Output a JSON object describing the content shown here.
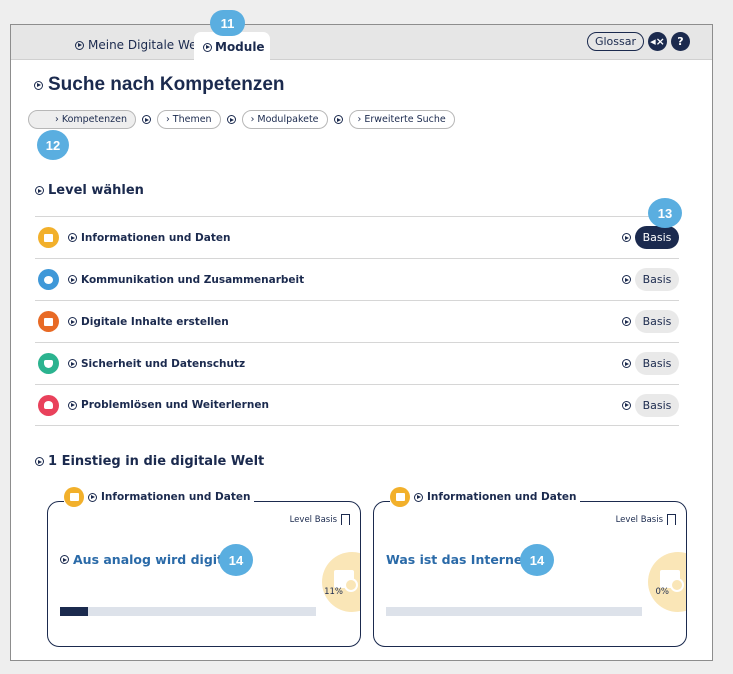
{
  "nav": {
    "tabs": [
      {
        "label": "Meine Digitale Welt",
        "active": false
      },
      {
        "label": "Module",
        "active": true
      }
    ],
    "glossar_label": "Glossar",
    "icons": {
      "sound": "speaker-mute-icon",
      "help": "help-icon"
    }
  },
  "markers": {
    "m11": "11",
    "m12": "12",
    "m13": "13",
    "m14a": "14",
    "m14b": "14"
  },
  "page": {
    "title": "Suche nach Kompetenzen",
    "filters": [
      {
        "label": "› Kompetenzen",
        "active": true
      },
      {
        "label": "› Themen",
        "active": false
      },
      {
        "label": "› Modulpakete",
        "active": false
      },
      {
        "label": "› Erweiterte Suche",
        "active": false
      }
    ]
  },
  "level": {
    "heading": "Level wählen",
    "rows": [
      {
        "label": "Informationen und Daten",
        "level": "Basis",
        "selected": true,
        "color": "#f2b02b"
      },
      {
        "label": "Kommunikation und Zusammenarbeit",
        "level": "Basis",
        "selected": false,
        "color": "#3f98d8"
      },
      {
        "label": "Digitale Inhalte erstellen",
        "level": "Basis",
        "selected": false,
        "color": "#e86a25"
      },
      {
        "label": "Sicherheit und Datenschutz",
        "level": "Basis",
        "selected": false,
        "color": "#2bb38f"
      },
      {
        "label": "Problemlösen und Weiterlernen",
        "level": "Basis",
        "selected": false,
        "color": "#e9415b"
      }
    ]
  },
  "modules": {
    "heading": "1 Einstieg in die digitale Welt",
    "cards": [
      {
        "category": "Informationen und Daten",
        "level": "Level Basis",
        "title": "Aus analog wird digital",
        "percent": "11%",
        "progress": 0.11
      },
      {
        "category": "Informationen und Daten",
        "level": "Level Basis",
        "title": "Was ist das Internet?",
        "percent": "0%",
        "progress": 0
      }
    ]
  },
  "colors": {
    "navy": "#1b2a4e",
    "marker": "#5aaee0",
    "link": "#2a6aa8"
  }
}
